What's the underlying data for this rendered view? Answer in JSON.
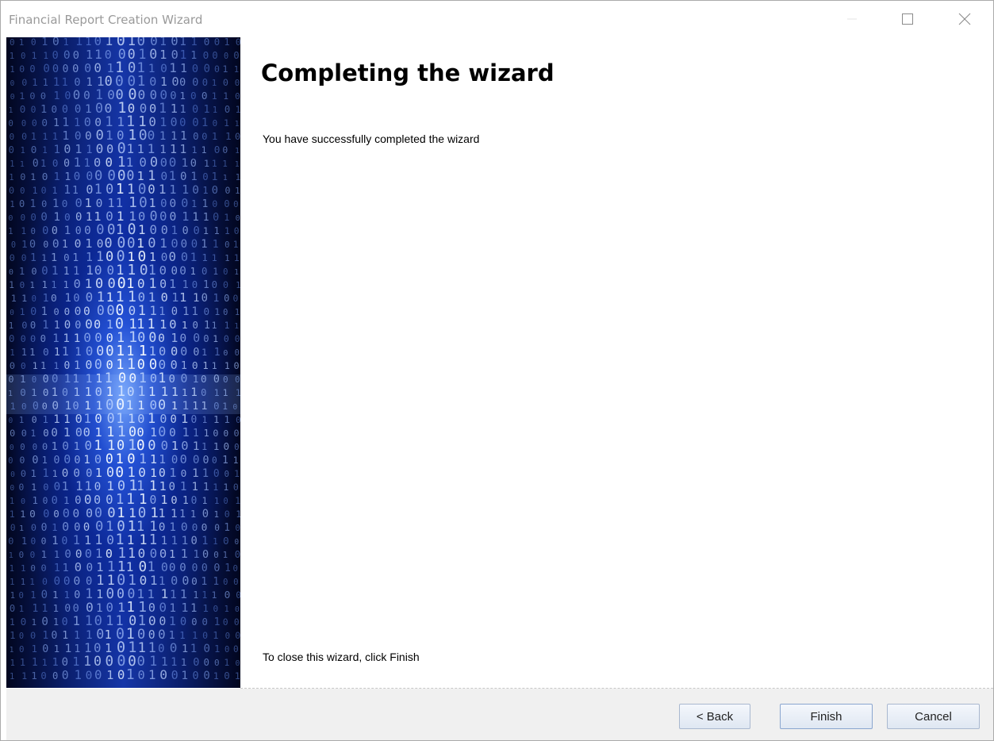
{
  "window": {
    "title": "Financial Report Creation Wizard"
  },
  "side_image": {
    "description_icon": "binary-code-tunnel-image"
  },
  "main": {
    "heading": "Completing the wizard",
    "description": "You have successfully completed the wizard",
    "close_hint": "To close this wizard, click Finish"
  },
  "footer": {
    "back_label": "< Back",
    "finish_label": "Finish",
    "cancel_label": "Cancel"
  },
  "colors": {
    "title_text": "#9a9a9a",
    "footer_bg": "#f0f0f0",
    "image_accent": "#1636a8"
  }
}
